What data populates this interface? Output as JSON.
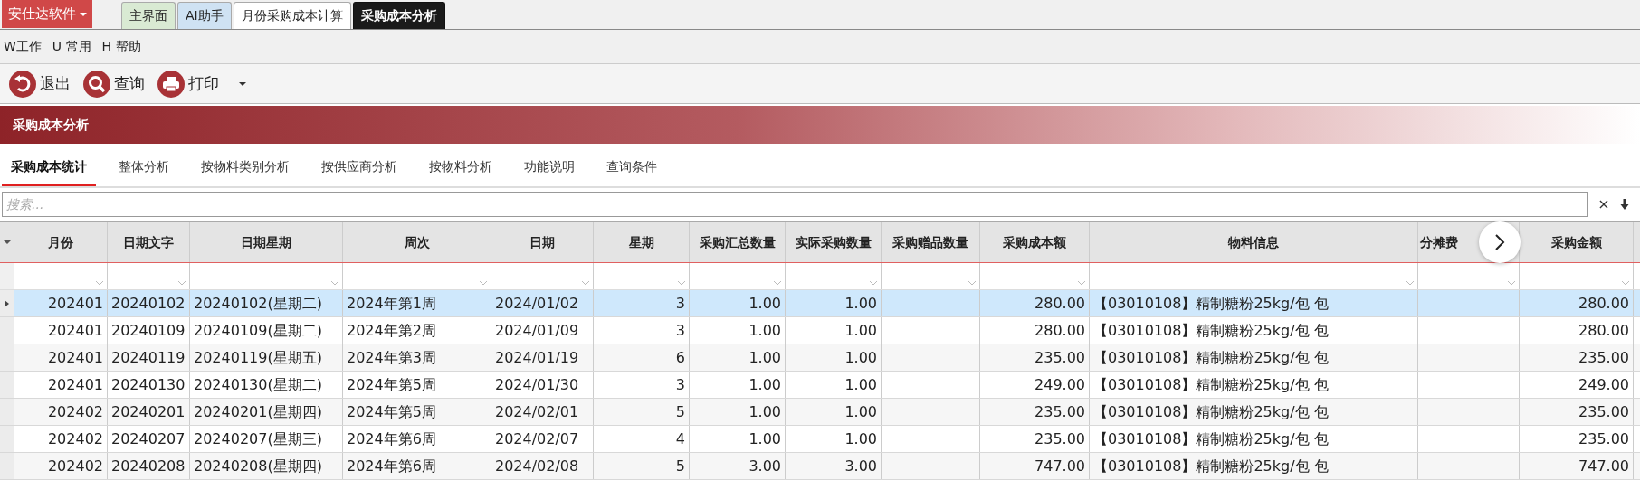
{
  "app_menu": {
    "label": "安仕达软件"
  },
  "window_tabs": [
    {
      "label": "主界面",
      "selected": false,
      "color": "#d9ead3"
    },
    {
      "label": "AI助手",
      "selected": false,
      "color": "#cfe2f3"
    },
    {
      "label": "月份采购成本计算",
      "selected": false,
      "color": "#ffffff"
    },
    {
      "label": "采购成本分析",
      "selected": true,
      "color": "#1a1a1a"
    }
  ],
  "menu": [
    {
      "key": "W",
      "label": "工作"
    },
    {
      "key": "U",
      "label": " 常用"
    },
    {
      "key": "H",
      "label": " 帮助"
    }
  ],
  "toolbar": [
    {
      "kind": "exit",
      "label": "退出",
      "dropdown": false
    },
    {
      "kind": "search",
      "label": "查询",
      "dropdown": false
    },
    {
      "kind": "print",
      "label": "打印",
      "dropdown": true
    }
  ],
  "panel_title": "采购成本分析",
  "tabs": [
    {
      "label": "采购成本统计",
      "selected": true
    },
    {
      "label": "整体分析",
      "selected": false
    },
    {
      "label": "按物料类别分析",
      "selected": false
    },
    {
      "label": "按供应商分析",
      "selected": false
    },
    {
      "label": "按物料分析",
      "selected": false
    },
    {
      "label": "功能说明",
      "selected": false
    },
    {
      "label": "查询条件",
      "selected": false
    }
  ],
  "search": {
    "placeholder": "搜索...",
    "clear": "×"
  },
  "table": {
    "columns": [
      "月份",
      "日期文字",
      "日期星期",
      "周次",
      "日期",
      "星期",
      "采购汇总数量",
      "实际采购数量",
      "采购赠品数量",
      "采购成本额",
      "物料信息",
      "分摊费",
      "采购金额"
    ],
    "rows": [
      {
        "selected": true,
        "cells": [
          "202401",
          "20240102",
          "20240102(星期二)",
          "2024年第1周",
          "2024/01/02",
          "3",
          "1.00",
          "1.00",
          "",
          "280.00",
          "【03010108】精制糖粉25kg/包 包",
          "",
          "280.00"
        ]
      },
      {
        "selected": false,
        "cells": [
          "202401",
          "20240109",
          "20240109(星期二)",
          "2024年第2周",
          "2024/01/09",
          "3",
          "1.00",
          "1.00",
          "",
          "280.00",
          "【03010108】精制糖粉25kg/包 包",
          "",
          "280.00"
        ]
      },
      {
        "selected": false,
        "cells": [
          "202401",
          "20240119",
          "20240119(星期五)",
          "2024年第3周",
          "2024/01/19",
          "6",
          "1.00",
          "1.00",
          "",
          "235.00",
          "【03010108】精制糖粉25kg/包 包",
          "",
          "235.00"
        ]
      },
      {
        "selected": false,
        "cells": [
          "202401",
          "20240130",
          "20240130(星期二)",
          "2024年第5周",
          "2024/01/30",
          "3",
          "1.00",
          "1.00",
          "",
          "249.00",
          "【03010108】精制糖粉25kg/包 包",
          "",
          "249.00"
        ]
      },
      {
        "selected": false,
        "cells": [
          "202402",
          "20240201",
          "20240201(星期四)",
          "2024年第5周",
          "2024/02/01",
          "5",
          "1.00",
          "1.00",
          "",
          "235.00",
          "【03010108】精制糖粉25kg/包 包",
          "",
          "235.00"
        ]
      },
      {
        "selected": false,
        "cells": [
          "202402",
          "20240207",
          "20240207(星期三)",
          "2024年第6周",
          "2024/02/07",
          "4",
          "1.00",
          "1.00",
          "",
          "235.00",
          "【03010108】精制糖粉25kg/包 包",
          "",
          "235.00"
        ]
      },
      {
        "selected": false,
        "cells": [
          "202402",
          "20240208",
          "20240208(星期四)",
          "2024年第6周",
          "2024/02/08",
          "5",
          "3.00",
          "3.00",
          "",
          "747.00",
          "【03010108】精制糖粉25kg/包 包",
          "",
          "747.00"
        ]
      }
    ]
  }
}
